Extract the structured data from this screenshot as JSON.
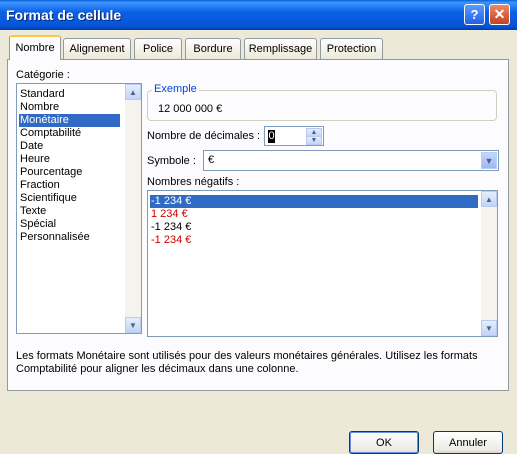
{
  "window": {
    "title": "Format de cellule"
  },
  "titlebar": {
    "help_label": "?",
    "close_label": "✕"
  },
  "tabs": [
    {
      "label": "Nombre",
      "active": true
    },
    {
      "label": "Alignement"
    },
    {
      "label": "Police"
    },
    {
      "label": "Bordure"
    },
    {
      "label": "Remplissage"
    },
    {
      "label": "Protection"
    }
  ],
  "category": {
    "label": "Catégorie :",
    "items": [
      "Standard",
      "Nombre",
      "Monétaire",
      "Comptabilité",
      "Date",
      "Heure",
      "Pourcentage",
      "Fraction",
      "Scientifique",
      "Texte",
      "Spécial",
      "Personnalisée"
    ],
    "selected": "Monétaire"
  },
  "example": {
    "label": "Exemple",
    "value": "12 000 000 €"
  },
  "decimals": {
    "label": "Nombre de décimales :",
    "value": "0"
  },
  "symbol": {
    "label": "Symbole :",
    "value": "€"
  },
  "negatives": {
    "label": "Nombres négatifs :",
    "items": [
      {
        "text": "-1 234 €",
        "color": "#000000",
        "selected": true
      },
      {
        "text": "1 234 €",
        "color": "#cc0000"
      },
      {
        "text": "-1 234 €",
        "color": "#000000"
      },
      {
        "text": "-1 234 €",
        "color": "#cc0000"
      }
    ]
  },
  "description": {
    "line1": "Les formats Monétaire sont utilisés pour des valeurs monétaires générales. Utilisez les formats",
    "line2": "Comptabilité pour aligner les décimaux dans une colonne."
  },
  "buttons": {
    "ok": "OK",
    "cancel": "Annuler"
  },
  "colors": {
    "titlebar": "#0554d6",
    "selection": "#316ac5",
    "negative_red": "#cc0000",
    "dialog_bg": "#ece9d8"
  }
}
